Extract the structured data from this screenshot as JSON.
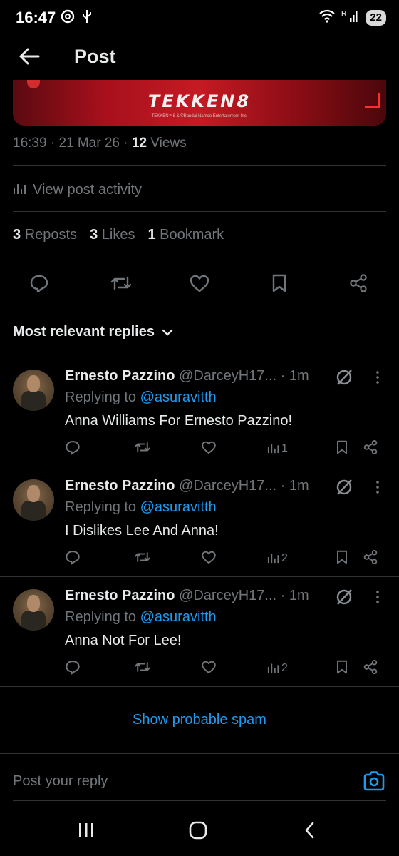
{
  "status_bar": {
    "time": "16:47",
    "battery": "22"
  },
  "header": {
    "title": "Post"
  },
  "media": {
    "logo_text": "TEKKEN8",
    "caption": "TEKKEN™8 & ©Bandai Namco Entertainment Inc."
  },
  "post_meta": {
    "time": "16:39",
    "date": "21 Mar 26",
    "views_count": "12",
    "views_label": "Views"
  },
  "activity": {
    "label": "View post activity"
  },
  "stats": [
    {
      "count": "3",
      "label": "Reposts"
    },
    {
      "count": "3",
      "label": "Likes"
    },
    {
      "count": "1",
      "label": "Bookmark"
    }
  ],
  "sort": {
    "label": "Most relevant replies"
  },
  "replies": [
    {
      "name": "Ernesto Pazzino",
      "handle": "@DarceyH17...",
      "time": "· 1m",
      "replying_prefix": "Replying to",
      "replying_to": "@asuravitth",
      "text": "Anna Williams For Ernesto Pazzino!",
      "views": "1"
    },
    {
      "name": "Ernesto Pazzino",
      "handle": "@DarceyH17...",
      "time": "· 1m",
      "replying_prefix": "Replying to",
      "replying_to": "@asuravitth",
      "text": "I Dislikes Lee And Anna!",
      "views": "2"
    },
    {
      "name": "Ernesto Pazzino",
      "handle": "@DarceyH17...",
      "time": "· 1m",
      "replying_prefix": "Replying to",
      "replying_to": "@asuravitth",
      "text": "Anna Not For Lee!",
      "views": "2"
    }
  ],
  "spam": {
    "label": "Show probable spam"
  },
  "reply_bar": {
    "placeholder": "Post your reply"
  },
  "colors": {
    "background": "#000000",
    "accent": "#1d9bf0",
    "muted": "#71767b",
    "text": "#e7e9ea",
    "divider": "#2f3336"
  }
}
